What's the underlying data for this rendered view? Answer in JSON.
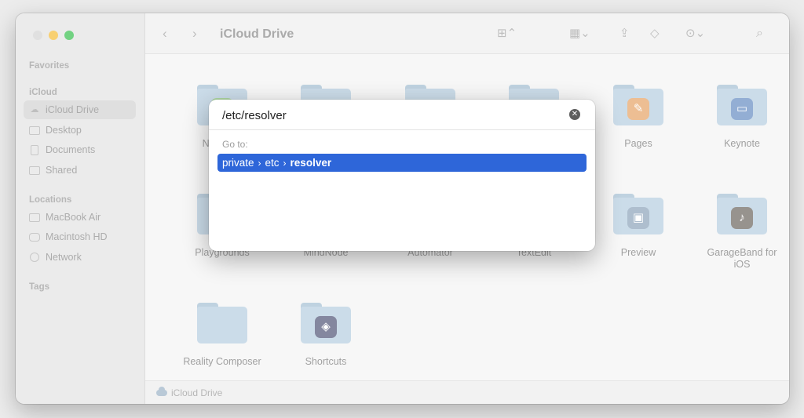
{
  "window": {
    "traffic_colors": [
      "#d4d4d4",
      "#f6be3b",
      "#3cc153"
    ]
  },
  "sidebar": {
    "favorites_title": "Favorites",
    "icloud_title": "iCloud",
    "icloud_items": [
      {
        "label": "iCloud Drive",
        "icon": "cloud-icon",
        "selected": true
      },
      {
        "label": "Desktop",
        "icon": "desktop-icon"
      },
      {
        "label": "Documents",
        "icon": "document-icon"
      },
      {
        "label": "Shared",
        "icon": "shared-folder-icon"
      }
    ],
    "locations_title": "Locations",
    "location_items": [
      {
        "label": "MacBook Air",
        "icon": "laptop-icon"
      },
      {
        "label": "Macintosh HD",
        "icon": "disk-icon"
      },
      {
        "label": "Network",
        "icon": "globe-icon"
      }
    ],
    "tags_title": "Tags"
  },
  "toolbar": {
    "title": "iCloud Drive",
    "back_icon": "chevron-left-icon",
    "forward_icon": "chevron-right-icon"
  },
  "content": {
    "items": [
      {
        "label": "Numbers",
        "app_icon": "numbers-icon",
        "app_color": "#8ec77d"
      },
      {
        "label": "",
        "app_icon": "",
        "app_color": ""
      },
      {
        "label": "",
        "app_icon": "",
        "app_color": ""
      },
      {
        "label": "",
        "app_icon": "",
        "app_color": ""
      },
      {
        "label": "Pages",
        "app_icon": "pages-icon",
        "app_color": "#e7a66a"
      },
      {
        "label": "Keynote",
        "app_icon": "keynote-icon",
        "app_color": "#6a8fc4"
      },
      {
        "label": "Playgrounds",
        "app_icon": "swift-icon",
        "app_color": "#e7785f"
      },
      {
        "label": "MindNode",
        "app_icon": "",
        "app_color": ""
      },
      {
        "label": "Automator",
        "app_icon": "",
        "app_color": ""
      },
      {
        "label": "TextEdit",
        "app_icon": "",
        "app_color": ""
      },
      {
        "label": "Preview",
        "app_icon": "preview-icon",
        "app_color": "#8fa6bb"
      },
      {
        "label": "GarageBand for iOS",
        "app_icon": "guitar-icon",
        "app_color": "#6f6a63"
      },
      {
        "label": "Reality Composer",
        "app_icon": "",
        "app_color": ""
      },
      {
        "label": "Shortcuts",
        "app_icon": "shortcuts-icon",
        "app_color": "#55597a"
      }
    ]
  },
  "statusbar": {
    "label": "iCloud Drive"
  },
  "dialog": {
    "input_value": "/etc/resolver",
    "goto_label": "Go to:",
    "result_path": [
      "private",
      "etc",
      "resolver"
    ],
    "accent": "#2e66d9"
  }
}
